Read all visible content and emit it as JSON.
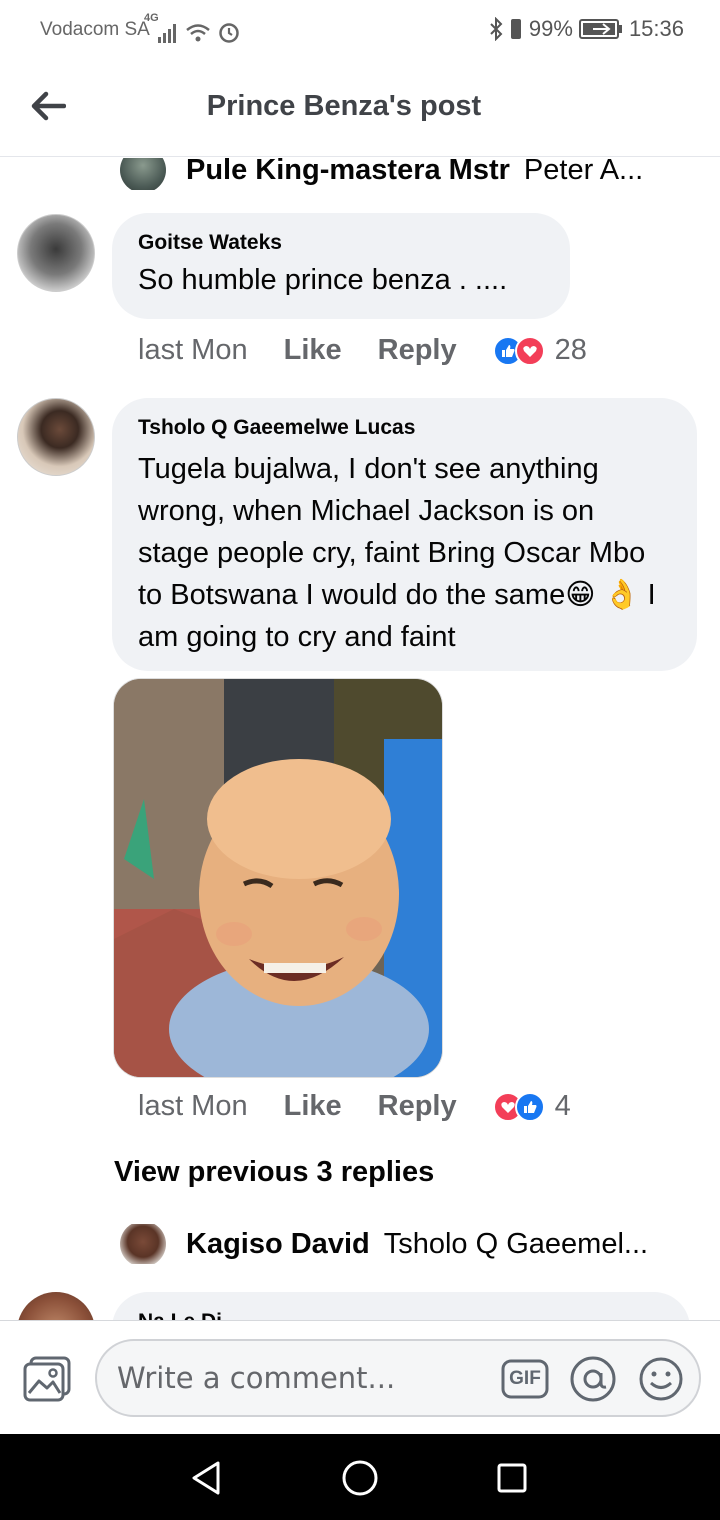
{
  "status_bar": {
    "carrier": "Vodacom SA",
    "network": "4G",
    "battery": "99%",
    "time": "15:36"
  },
  "header": {
    "title": "Prince Benza's post"
  },
  "thread": {
    "top_reply": {
      "name": "Pule King-mastera Mstr",
      "text": "Peter A..."
    },
    "comments": [
      {
        "name": "Goitse Wateks",
        "text": "So humble prince benza .  ....",
        "time": "last Mon",
        "like_label": "Like",
        "reply_label": "Reply",
        "reaction_count": "28",
        "reactions": [
          "like-icon",
          "love-icon"
        ]
      },
      {
        "name": "Tsholo Q Gaeemelwe Lucas",
        "text": "Tugela bujalwa, I don't see anything wrong, when Michael Jackson is on stage people cry, faint Bring Oscar Mbo to Botswana I would do the same😁 👌 I am going to cry and faint",
        "time": "last Mon",
        "like_label": "Like",
        "reply_label": "Reply",
        "reaction_count": "4",
        "reactions": [
          "love-icon",
          "like-icon"
        ]
      }
    ],
    "view_previous": "View previous 3 replies",
    "bottom_reply": {
      "name": "Kagiso David",
      "text": "Tsholo Q Gaeemel..."
    },
    "partial_name": "Na Le Di"
  },
  "composer": {
    "placeholder": "Write a comment...",
    "gif_label": "GIF"
  },
  "colors": {
    "like_blue": "#1877f2",
    "love_red": "#f33e58",
    "bubble_bg": "#f0f2f5",
    "meta_gray": "#65676b"
  }
}
